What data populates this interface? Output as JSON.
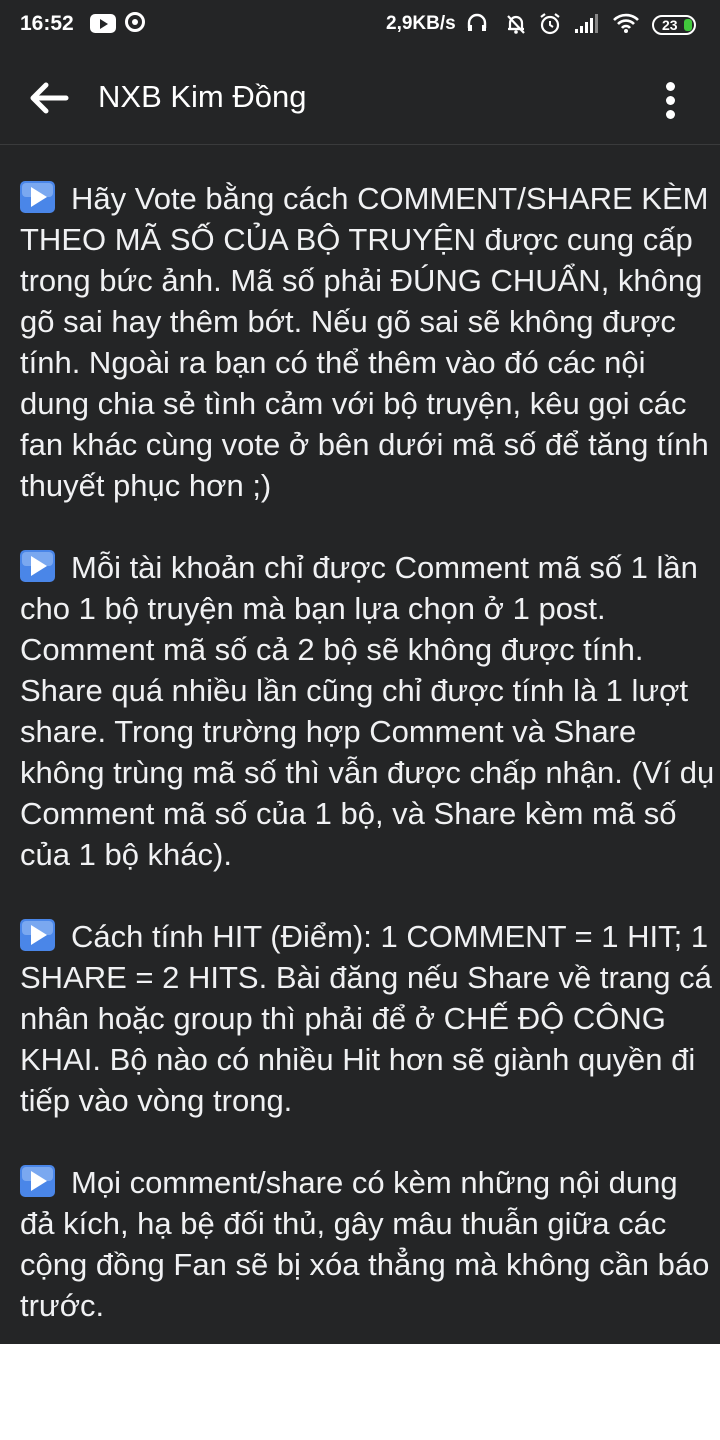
{
  "status_bar": {
    "time": "16:52",
    "network_speed": "2,9KB/s",
    "battery_level": "23",
    "battery_color": "#41c93c"
  },
  "toolbar": {
    "back_icon": "arrow-left-icon",
    "title": "NXB Kim Đồng",
    "more_icon": "more-vertical-icon"
  },
  "content": {
    "bullet_icon": "play-button-icon",
    "paragraphs": [
      "Hãy Vote bằng cách COMMENT/SHARE KÈM THEO MÃ SỐ CỦA BỘ TRUYỆN được cung cấp trong bức ảnh. Mã số phải ĐÚNG CHUẨN, không gõ sai hay thêm bớt. Nếu gõ sai sẽ không được tính. Ngoài ra bạn có thể thêm vào đó các nội dung chia sẻ tình cảm với bộ truyện, kêu gọi các fan khác cùng vote ở bên dưới mã số để tăng tính thuyết phục hơn ;)",
      "Mỗi tài khoản chỉ được Comment mã số 1 lần cho 1 bộ truyện mà bạn lựa chọn ở 1 post. Comment mã số cả 2 bộ sẽ không được tính. Share quá nhiều lần cũng chỉ được tính là 1 lượt share. Trong trường hợp Comment và Share không trùng mã số thì vẫn được chấp nhận. (Ví dụ Comment mã số của 1 bộ, và Share kèm mã số của 1 bộ khác).",
      "Cách tính HIT (Điểm): 1 COMMENT = 1 HIT; 1 SHARE = 2 HITS. Bài đăng nếu Share về trang cá nhân hoặc group thì phải để ở CHẾ ĐỘ CÔNG KHAI. Bộ nào có nhiều Hit hơn sẽ giành quyền đi tiếp vào vòng trong.",
      "Mọi comment/share có kèm những nội dung đả kích, hạ bệ đối thủ, gây mâu thuẫn giữa các cộng đồng Fan sẽ bị xóa thẳng mà không cần báo trước."
    ]
  },
  "colors": {
    "background": "#242526",
    "text": "#f0f1f3",
    "bullet_blue": "#4a86e8"
  }
}
